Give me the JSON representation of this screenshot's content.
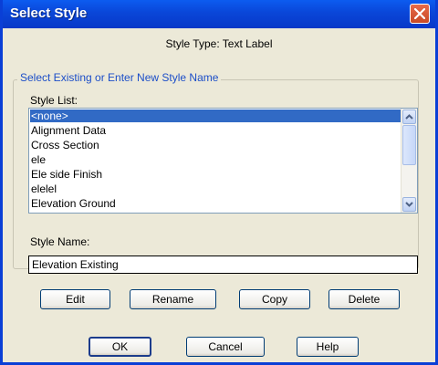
{
  "window": {
    "title": "Select Style"
  },
  "subtitle": "Style Type: Text Label",
  "group": {
    "legend": "Select Existing or Enter New Style Name",
    "style_list_label": "Style List:",
    "style_list": [
      {
        "label": "<none>",
        "selected": true
      },
      {
        "label": "Alignment Data",
        "selected": false
      },
      {
        "label": "Cross Section",
        "selected": false
      },
      {
        "label": "ele",
        "selected": false
      },
      {
        "label": "Ele side Finish",
        "selected": false
      },
      {
        "label": "elelel",
        "selected": false
      },
      {
        "label": "Elevation Ground",
        "selected": false
      }
    ],
    "style_name_label": "Style Name:",
    "style_name_value": "Elevation Existing"
  },
  "actions": {
    "edit": "Edit",
    "rename": "Rename",
    "copy": "Copy",
    "delete": "Delete"
  },
  "footer": {
    "ok": "OK",
    "cancel": "Cancel",
    "help": "Help"
  },
  "colors": {
    "titlebar": "#0a46d8",
    "selection": "#316ac5",
    "legend": "#1c4ec8",
    "close": "#d05a36"
  }
}
